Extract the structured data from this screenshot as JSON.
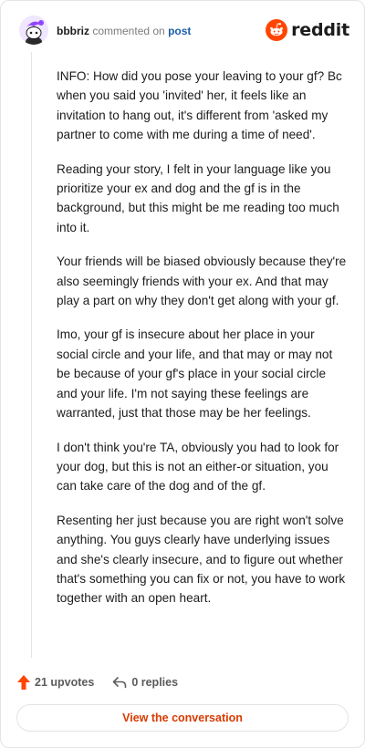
{
  "header": {
    "username": "bbbriz",
    "commented_on": "commented on",
    "post_link": "post",
    "brand": "reddit",
    "brand_color": "#ff4500"
  },
  "comment": {
    "paragraphs": [
      "INFO: How did you pose your leaving to your gf? Bc when you said you 'invited' her, it feels like an invitation to hang out, it's different from 'asked my partner to come with me during a time of need'.",
      "Reading your story, I felt in your language like you prioritize your ex and dog and the gf is in the background, but this might be me reading too much into it.",
      "Your friends will be biased obviously because they're also seemingly friends with your ex. And that may play a part on why they don't get along with your gf.",
      "Imo, your gf is insecure about her place in your social circle and your life, and that may or may not be because of your gf's place in your social circle and your life. I'm not saying these feelings are warranted, just that those may be her feelings.",
      "I don't think you're TA, obviously you had to look for your dog, but this is not an either-or situation, you can take care of the dog and of the gf.",
      "Resenting her just because you are right won't solve anything. You guys clearly have underlying issues and she's clearly insecure, and to figure out whether that's something you can fix or not, you have to work together with an open heart."
    ]
  },
  "actions": {
    "upvotes": "21 upvotes",
    "replies": "0 replies",
    "upvote_icon": "upvote-arrow-icon",
    "reply_icon": "reply-arrow-icon",
    "upvote_color": "#ff4500"
  },
  "view_button": {
    "label": "View the conversation",
    "color": "#d93a00"
  }
}
